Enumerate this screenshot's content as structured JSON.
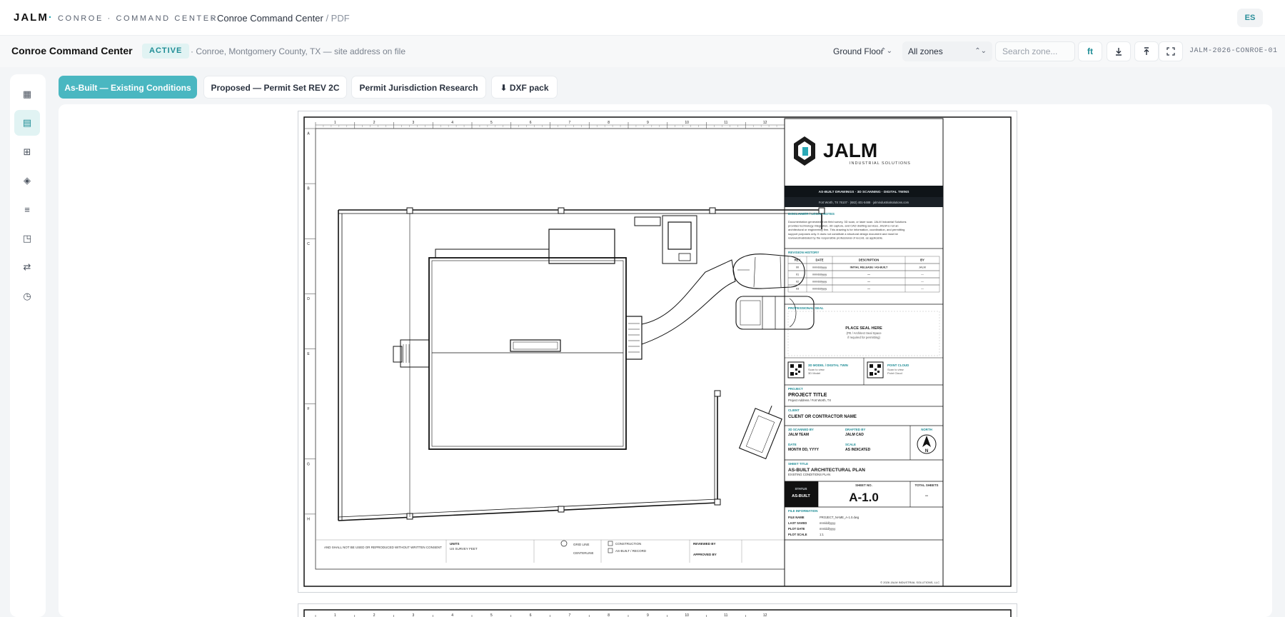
{
  "nav": {
    "brand": "JALM",
    "brand_dot": "·",
    "brand_sub": "CONROE · COMMAND CENTER",
    "crumb_sep": "›",
    "crumb_current": "Conroe Command Center",
    "crumb_doc": "/ PDF",
    "language": "ES"
  },
  "project": {
    "title": "Conroe Command Center",
    "status": "ACTIVE",
    "address": "· Conroe, Montgomery County, TX — site address on file",
    "floor": "Ground Floor",
    "zones": "All zones",
    "search_placeholder": "Search zone...",
    "unit_button": "ft",
    "code": "JALM-2026-CONROE-01"
  },
  "toolbar_icons": [
    "download-icon",
    "upload-icon",
    "fullscreen-icon"
  ],
  "rail": [
    {
      "name": "rail-dashboard",
      "icon": "▦"
    },
    {
      "name": "rail-plans",
      "icon": "▤"
    },
    {
      "name": "rail-grid",
      "icon": "⊞"
    },
    {
      "name": "rail-layers",
      "icon": "◈"
    },
    {
      "name": "rail-list",
      "icon": "≡"
    },
    {
      "name": "rail-sheets",
      "icon": "◳"
    },
    {
      "name": "rail-transfer",
      "icon": "⇄"
    },
    {
      "name": "rail-history",
      "icon": "◷"
    }
  ],
  "tabs": [
    {
      "label": "As-Built — Existing Conditions",
      "active": true
    },
    {
      "label": "Proposed — Permit Set REV 2C",
      "active": false
    },
    {
      "label": "Permit Jurisdiction Research",
      "active": false
    },
    {
      "label": "⬇ DXF pack",
      "active": false
    }
  ],
  "sheet": {
    "col_numbers": [
      "1",
      "2",
      "3",
      "4",
      "5",
      "6",
      "7",
      "8",
      "9",
      "10",
      "11",
      "12"
    ],
    "row_letters": [
      "A",
      "B",
      "C",
      "D",
      "E",
      "F",
      "G",
      "H"
    ],
    "logo_name": "JALM",
    "logo_sub": "INDUSTRIAL SOLUTIONS",
    "banner": "AS-BUILT DRAWINGS · 3D SCANNING · DIGITAL TWINS",
    "contact": "Fort Worth, TX 76107 · (682) 401-5488 · jalmindustrialsolutions.com",
    "disclaimer_title": "DISCLAIMER / LEGAL NOTES",
    "disclaimer_lines": [
      "Documentation generated from field survey, 3D scan, or laser scan. JALM Industrial Solutions",
      "provides technology integration, 3D capture, and CAD drafting services. JALM is not an",
      "architectural or engineering firm. This drawing is for information, coordination, and permitting",
      "support purposes only. It does not constitute a structural design document and must be",
      "reviewed/validated by the responsible professional of record, as applicable."
    ],
    "revision_title": "REVISION HISTORY",
    "revision_headers": [
      "REV",
      "DATE",
      "DESCRIPTION",
      "BY"
    ],
    "revision_rows": [
      [
        "00",
        "mm/dd/yyyy",
        "INITIAL RELEASE / AS-BUILT",
        "JALM"
      ],
      [
        "01",
        "mm/dd/yyyy",
        "—",
        "—"
      ],
      [
        "02",
        "mm/dd/yyyy",
        "—",
        "—"
      ],
      [
        "03",
        "mm/dd/yyyy",
        "—",
        "—"
      ]
    ],
    "seal_title": "PROFESSIONAL SEAL",
    "seal_place": "PLACE SEAL HERE",
    "seal_sub1": "(PE / Architect Seal Space",
    "seal_sub2": "if required for permitting)",
    "qr1_title": "3D MODEL / DIGITAL TWIN",
    "qr1_l1": "Scan to view",
    "qr1_l2": "3D Model",
    "qr2_title": "POINT CLOUD",
    "qr2_l1": "Scan to view",
    "qr2_l2": "Point Cloud",
    "project_label": "PROJECT",
    "project_value": "PROJECT TITLE",
    "project_sub": "Project Address / Fort Worth, TX",
    "client_label": "CLIENT",
    "client_value": "CLIENT OR CONTRACTOR NAME",
    "scanned_label": "3D SCANNED BY",
    "scanned_value": "JALM TEAM",
    "drafted_label": "DRAFTED BY",
    "drafted_value": "JALM CAD",
    "north_label": "NORTH",
    "north_letter": "N",
    "date_label": "DATE",
    "date_value": "MONTH DD, YYYY",
    "scale_label": "SCALE",
    "scale_value": "AS INDICATED",
    "title_label": "SHEET TITLE",
    "title_value": "AS-BUILT ARCHITECTURAL PLAN",
    "title_sub": "EXISTING CONDITIONS PLAN",
    "status_label": "STATUS",
    "status_value": "AS-BUILT",
    "sheetno_label": "SHEET NO.",
    "sheetno_value": "A-1.0",
    "total_label": "TOTAL SHEETS",
    "total_value": "--",
    "file_title": "FILE INFORMATION",
    "file_rows": [
      [
        "FILE NAME",
        "PROJECT_NAME_A-1.0.dwg"
      ],
      [
        "LAST SAVED",
        "mm/dd/yyyy"
      ],
      [
        "PLOT DATE",
        "mm/dd/yyyy"
      ],
      [
        "PLOT SCALE",
        "1:1"
      ]
    ],
    "copyright": "© 2026 JALM INDUSTRIAL SOLUTIONS, LLC",
    "note_bottom": "AND SHALL NOT BE USED OR REPRODUCED WITHOUT WRITTEN CONSENT",
    "units_label": "UNITS",
    "units_value": "US SURVEY FEET",
    "legend_grid": "GRID LINE",
    "legend_center": "CENTERLINE",
    "legend_construction": "CONSTRUCTION",
    "legend_record": "AS-BUILT / RECORD",
    "reviewed": "REVIEWED BY",
    "approved": "APPROVED BY"
  }
}
